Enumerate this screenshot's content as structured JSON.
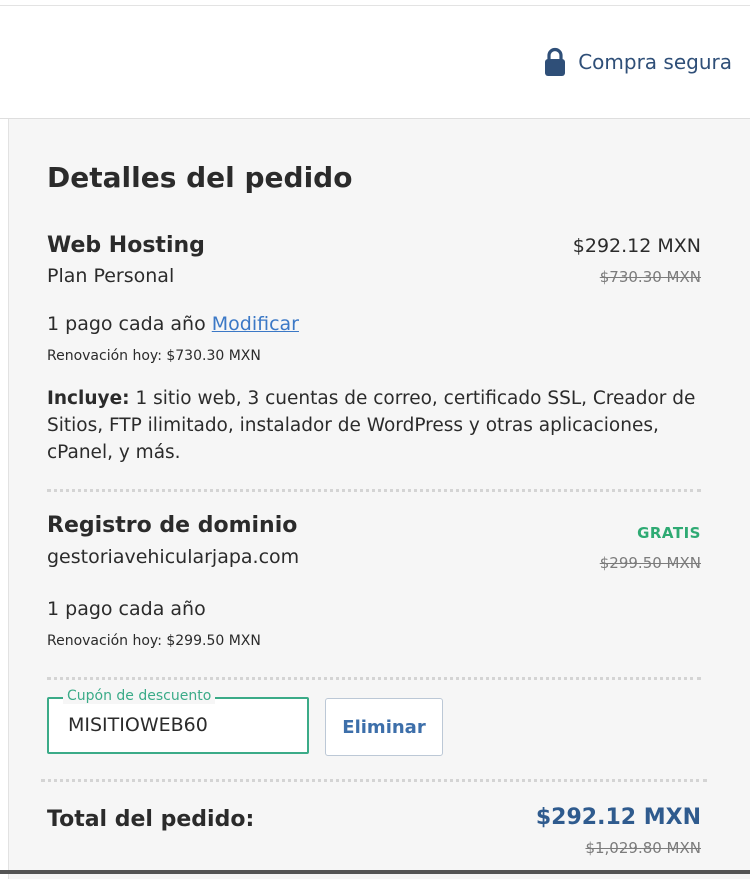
{
  "header": {
    "secure_label": "Compra segura",
    "secure_icon": "lock-icon",
    "accent_color": "#2f4f78"
  },
  "order": {
    "title": "Detalles del pedido",
    "hosting": {
      "name": "Web Hosting",
      "plan": "Plan Personal",
      "price": "$292.12 MXN",
      "original_price": "$730.30 MXN",
      "payment": "1 pago cada año",
      "modify_link": "Modificar",
      "renewal": "Renovación hoy: $730.30 MXN",
      "includes_label": "Incluye:",
      "includes_text": "1 sitio web, 3 cuentas de correo, certificado SSL, Creador de Sitios, FTP ilimitado, instalador de WordPress y otras aplicaciones, cPanel, y más."
    },
    "domain": {
      "name": "Registro de dominio",
      "domain_name": "gestoriavehicularjapa.com",
      "price": "GRATIS",
      "original_price": "$299.50 MXN",
      "payment": "1 pago cada año",
      "renewal": "Renovación hoy: $299.50 MXN"
    },
    "coupon": {
      "label": "Cupón de descuento",
      "value": "MISITIOWEB60",
      "remove_label": "Eliminar"
    },
    "total": {
      "label": "Total del pedido:",
      "price": "$292.12 MXN",
      "original_price": "$1,029.80 MXN"
    },
    "colors": {
      "free": "#2eaa73",
      "total": "#2f5b8e",
      "coupon_border": "#3bab88",
      "link": "#3b78c6"
    }
  }
}
